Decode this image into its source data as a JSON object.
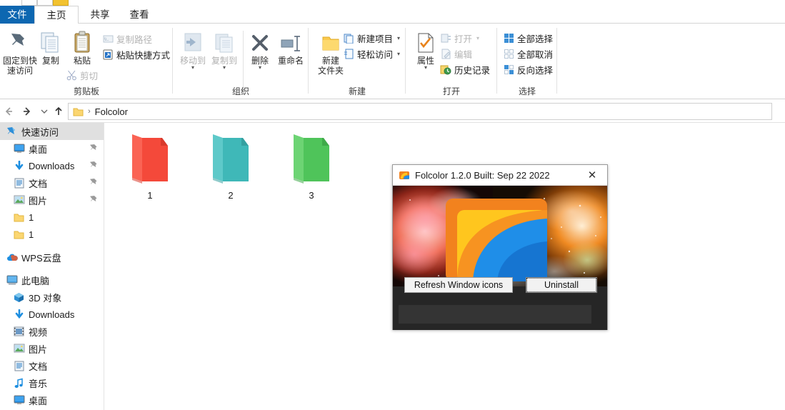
{
  "window": {
    "quick_access": [
      "qa-item-1",
      "qa-item-2",
      "qa-item-3"
    ]
  },
  "ribbon": {
    "tabs": [
      {
        "label": "文件",
        "name": "tab-file",
        "active": false
      },
      {
        "label": "主页",
        "name": "tab-home",
        "active": true
      },
      {
        "label": "共享",
        "name": "tab-share",
        "active": false
      },
      {
        "label": "查看",
        "name": "tab-view",
        "active": false
      }
    ],
    "groups": [
      {
        "title": "剪贴板",
        "big": [
          {
            "label_line1": "固定到快",
            "label_line2": "速访问",
            "icon": "pin-icon",
            "dim": false
          },
          {
            "label_line1": "复制",
            "label_line2": "",
            "icon": "copy-icon",
            "dim": false
          },
          {
            "label_line1": "粘贴",
            "label_line2": "",
            "icon": "paste-icon",
            "dim": false
          }
        ],
        "small": [
          {
            "label": "复制路径",
            "icon": "copy-path-icon",
            "dim": true
          },
          {
            "label": "粘贴快捷方式",
            "icon": "paste-shortcut-icon",
            "dim": false
          },
          {
            "label": "剪切",
            "icon": "scissors-icon",
            "dim": true
          }
        ]
      },
      {
        "title": "组织",
        "big": [
          {
            "label_line1": "移动到",
            "label_line2": "",
            "icon": "move-to-icon",
            "dim": true,
            "caret": true
          },
          {
            "label_line1": "复制到",
            "label_line2": "",
            "icon": "copy-to-icon",
            "dim": true,
            "caret": true
          },
          {
            "label_line1": "删除",
            "label_line2": "",
            "icon": "delete-x-icon",
            "dim": false,
            "caret": true
          },
          {
            "label_line1": "重命名",
            "label_line2": "",
            "icon": "rename-icon",
            "dim": false
          }
        ],
        "small": []
      },
      {
        "title": "新建",
        "big": [
          {
            "label_line1": "新建",
            "label_line2": "文件夹",
            "icon": "new-folder-icon",
            "dim": false
          }
        ],
        "small": [
          {
            "label": "新建项目",
            "icon": "new-item-icon",
            "dim": false,
            "caret": true
          },
          {
            "label": "轻松访问",
            "icon": "easy-access-icon",
            "dim": false,
            "caret": true
          }
        ]
      },
      {
        "title": "打开",
        "big": [
          {
            "label_line1": "属性",
            "label_line2": "",
            "icon": "properties-icon",
            "dim": false,
            "caret": true
          }
        ],
        "small": [
          {
            "label": "打开",
            "icon": "open-icon",
            "dim": true,
            "caret": true
          },
          {
            "label": "编辑",
            "icon": "edit-icon",
            "dim": true
          },
          {
            "label": "历史记录",
            "icon": "history-icon",
            "dim": false
          }
        ]
      },
      {
        "title": "选择",
        "big": [],
        "small": [
          {
            "label": "全部选择",
            "icon": "select-all-icon",
            "dim": false
          },
          {
            "label": "全部取消",
            "icon": "select-none-icon",
            "dim": false
          },
          {
            "label": "反向选择",
            "icon": "invert-selection-icon",
            "dim": false
          }
        ]
      }
    ]
  },
  "navbar": {
    "back": "◄",
    "forward": "►",
    "recent": "▾",
    "up": "▲",
    "breadcrumb": {
      "folder_icon": "folder-icon",
      "separator": "›",
      "path": "Folcolor"
    }
  },
  "sidebar": {
    "items": [
      {
        "label": "快速访问",
        "icon": "quick-access-pin-icon",
        "indent": 8,
        "selected": true,
        "pinned": false
      },
      {
        "label": "桌面",
        "icon": "desktop-icon",
        "indent": 18,
        "selected": false,
        "pinned": true
      },
      {
        "label": "Downloads",
        "icon": "downloads-icon",
        "indent": 18,
        "selected": false,
        "pinned": true
      },
      {
        "label": "文档",
        "icon": "documents-icon",
        "indent": 18,
        "selected": false,
        "pinned": true
      },
      {
        "label": "图片",
        "icon": "pictures-icon",
        "indent": 18,
        "selected": false,
        "pinned": true
      },
      {
        "label": "1",
        "icon": "folder-icon",
        "indent": 18,
        "selected": false,
        "pinned": false
      },
      {
        "label": "1",
        "icon": "folder-icon",
        "indent": 18,
        "selected": false,
        "pinned": false
      },
      {
        "label": "WPS云盘",
        "icon": "wps-cloud-icon",
        "indent": 8,
        "selected": false,
        "pinned": false
      },
      {
        "label": "此电脑",
        "icon": "this-pc-icon",
        "indent": 8,
        "selected": false,
        "pinned": false
      },
      {
        "label": "3D 对象",
        "icon": "3d-objects-icon",
        "indent": 18,
        "selected": false,
        "pinned": false
      },
      {
        "label": "Downloads",
        "icon": "downloads-icon",
        "indent": 18,
        "selected": false,
        "pinned": false
      },
      {
        "label": "视频",
        "icon": "videos-icon",
        "indent": 18,
        "selected": false,
        "pinned": false
      },
      {
        "label": "图片",
        "icon": "pictures-icon",
        "indent": 18,
        "selected": false,
        "pinned": false
      },
      {
        "label": "文档",
        "icon": "documents-icon",
        "indent": 18,
        "selected": false,
        "pinned": false
      },
      {
        "label": "音乐",
        "icon": "music-icon",
        "indent": 18,
        "selected": false,
        "pinned": false
      },
      {
        "label": "桌面",
        "icon": "desktop-icon",
        "indent": 18,
        "selected": false,
        "pinned": false
      }
    ]
  },
  "content": {
    "folders": [
      {
        "name": "1",
        "color": "#f4493a",
        "dark": "#d93a2c",
        "light": "#fa6354"
      },
      {
        "name": "2",
        "color": "#3fb8b8",
        "dark": "#34a0a0",
        "light": "#5ec9c9"
      },
      {
        "name": "3",
        "color": "#4fc45a",
        "dark": "#3faa49",
        "light": "#6dd474"
      }
    ]
  },
  "dialog": {
    "title": "Folcolor 1.2.0 Built: Sep 22 2022",
    "icon": "folcolor-app-icon",
    "close_label": "✕",
    "buttons": [
      {
        "label": "Refresh Window icons",
        "name": "refresh-window-icons-button",
        "focused": false
      },
      {
        "label": "Uninstall",
        "name": "uninstall-button",
        "focused": true
      }
    ],
    "banner_alt": "folcolor-logo-banner"
  }
}
